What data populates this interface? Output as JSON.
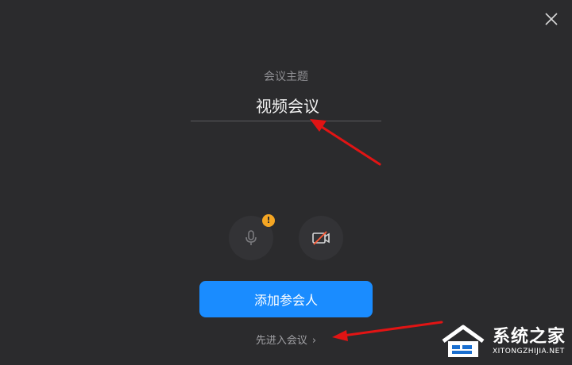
{
  "meeting": {
    "subject_label": "会议主题",
    "subject_value": "视频会议",
    "add_participants_label": "添加参会人",
    "enter_first_label": "先进入会议",
    "enter_chevron": "›",
    "mic_warning_badge": "!"
  },
  "icons": {
    "close": "close-icon",
    "mic": "microphone-icon",
    "camera": "camera-off-icon",
    "chevron": "chevron-right-icon"
  },
  "colors": {
    "background": "#2b2b2d",
    "primary_button": "#1a8cff",
    "warning_badge": "#f5a623",
    "camera_off_slash": "#ff5a36",
    "annotation_arrow": "#e11414"
  },
  "watermark": {
    "text_cn": "系统之家",
    "text_en": "XITONGZHIJIA.NET"
  }
}
